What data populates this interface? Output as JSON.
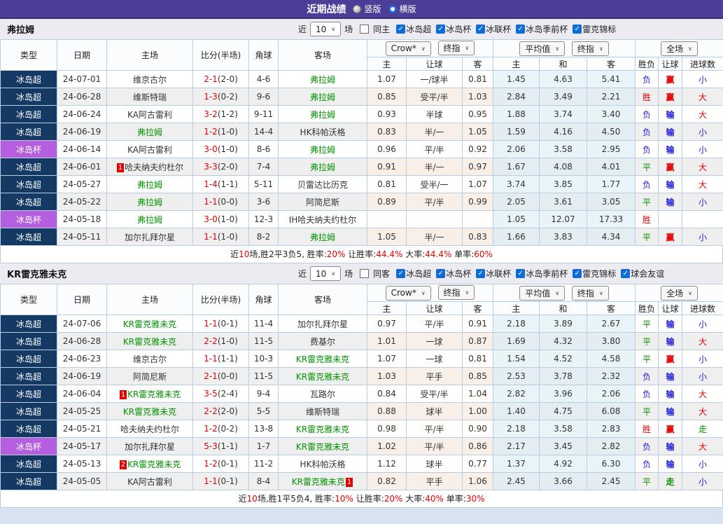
{
  "titlebar": {
    "title": "近期战绩",
    "radios": [
      {
        "label": "竖版",
        "selected": false
      },
      {
        "label": "横版",
        "selected": true
      }
    ]
  },
  "header": {
    "cols": [
      "类型",
      "日期",
      "主场",
      "比分(半场)",
      "角球",
      "客场"
    ],
    "dropdowns": [
      "Crow*",
      "终指",
      "平均值",
      "终指",
      "全场"
    ],
    "subcols": [
      "主",
      "让球",
      "客",
      "主",
      "和",
      "客",
      "胜负",
      "让球",
      "进球数"
    ]
  },
  "colors": {
    "titlebar": "#4c3d96",
    "league_super": "#143a64",
    "league_cup": "#b55fe0",
    "focus_team": "#009500",
    "win_red": "#e60000",
    "draw_green": "#089000",
    "lose_blue": "#2121dd",
    "score_red": "#e80000",
    "checkbox_blue": "#0e6cd6"
  },
  "sections": [
    {
      "team": "弗拉姆",
      "filter": {
        "prefix": "近",
        "count": "10",
        "suffix": "场",
        "same": "同主",
        "leagues": [
          "冰岛超",
          "冰岛杯",
          "冰联杯",
          "冰岛季前杯",
          "雷克锦标"
        ]
      },
      "rows": [
        {
          "type": "冰岛超",
          "tc": "super",
          "date": "24-07-01",
          "home": "维京古尔",
          "hg": false,
          "hb": "",
          "score": "2-1",
          "half": "(2-0)",
          "corner": "4-6",
          "away": "弗拉姆",
          "ag": true,
          "ab": "",
          "o1": [
            "1.07",
            "一/球半",
            "0.81"
          ],
          "o2": [
            "1.45",
            "4.63",
            "5.41"
          ],
          "res": [
            "负",
            "赢",
            "小"
          ]
        },
        {
          "type": "冰岛超",
          "tc": "super",
          "date": "24-06-28",
          "home": "维斯特瑞",
          "hg": false,
          "hb": "",
          "score": "1-3",
          "half": "(0-2)",
          "corner": "9-6",
          "away": "弗拉姆",
          "ag": true,
          "ab": "",
          "o1": [
            "0.85",
            "受平/半",
            "1.03"
          ],
          "o2": [
            "2.84",
            "3.49",
            "2.21"
          ],
          "res": [
            "胜",
            "赢",
            "大"
          ]
        },
        {
          "type": "冰岛超",
          "tc": "super",
          "date": "24-06-24",
          "home": "KA阿古雷利",
          "hg": false,
          "hb": "",
          "score": "3-2",
          "half": "(1-2)",
          "corner": "9-11",
          "away": "弗拉姆",
          "ag": true,
          "ab": "",
          "o1": [
            "0.93",
            "半球",
            "0.95"
          ],
          "o2": [
            "1.88",
            "3.74",
            "3.40"
          ],
          "res": [
            "负",
            "输",
            "大"
          ]
        },
        {
          "type": "冰岛超",
          "tc": "super",
          "date": "24-06-19",
          "home": "弗拉姆",
          "hg": true,
          "hb": "",
          "score": "1-2",
          "half": "(1-0)",
          "corner": "14-4",
          "away": "HK科帕沃格",
          "ag": false,
          "ab": "",
          "o1": [
            "0.83",
            "半/一",
            "1.05"
          ],
          "o2": [
            "1.59",
            "4.16",
            "4.50"
          ],
          "res": [
            "负",
            "输",
            "小"
          ]
        },
        {
          "type": "冰岛杯",
          "tc": "cup",
          "date": "24-06-14",
          "home": "KA阿古雷利",
          "hg": false,
          "hb": "",
          "score": "3-0",
          "half": "(1-0)",
          "corner": "8-6",
          "away": "弗拉姆",
          "ag": true,
          "ab": "",
          "o1": [
            "0.96",
            "平/半",
            "0.92"
          ],
          "o2": [
            "2.06",
            "3.58",
            "2.95"
          ],
          "res": [
            "负",
            "输",
            "小"
          ]
        },
        {
          "type": "冰岛超",
          "tc": "super",
          "date": "24-06-01",
          "home": "哈夫纳夫约杜尔",
          "hg": false,
          "hb": "1",
          "score": "3-3",
          "half": "(2-0)",
          "corner": "7-4",
          "away": "弗拉姆",
          "ag": true,
          "ab": "",
          "o1": [
            "0.91",
            "半/一",
            "0.97"
          ],
          "o2": [
            "1.67",
            "4.08",
            "4.01"
          ],
          "res": [
            "平",
            "赢",
            "大"
          ]
        },
        {
          "type": "冰岛超",
          "tc": "super",
          "date": "24-05-27",
          "home": "弗拉姆",
          "hg": true,
          "hb": "",
          "score": "1-4",
          "half": "(1-1)",
          "corner": "5-11",
          "away": "贝雷达比历克",
          "ag": false,
          "ab": "",
          "o1": [
            "0.81",
            "受半/一",
            "1.07"
          ],
          "o2": [
            "3.74",
            "3.85",
            "1.77"
          ],
          "res": [
            "负",
            "输",
            "大"
          ]
        },
        {
          "type": "冰岛超",
          "tc": "super",
          "date": "24-05-22",
          "home": "弗拉姆",
          "hg": true,
          "hb": "",
          "score": "1-1",
          "half": "(0-0)",
          "corner": "3-6",
          "away": "阿简尼斯",
          "ag": false,
          "ab": "",
          "o1": [
            "0.89",
            "平/半",
            "0.99"
          ],
          "o2": [
            "2.05",
            "3.61",
            "3.05"
          ],
          "res": [
            "平",
            "输",
            "小"
          ]
        },
        {
          "type": "冰岛杯",
          "tc": "cup",
          "date": "24-05-18",
          "home": "弗拉姆",
          "hg": true,
          "hb": "",
          "score": "3-0",
          "half": "(1-0)",
          "corner": "12-3",
          "away": "IH哈夫纳夫约杜尔",
          "ag": false,
          "ab": "",
          "o1": [
            "",
            "",
            ""
          ],
          "o2": [
            "1.05",
            "12.07",
            "17.33"
          ],
          "res": [
            "胜",
            "",
            ""
          ]
        },
        {
          "type": "冰岛超",
          "tc": "super",
          "date": "24-05-11",
          "home": "加尔扎拜尔星",
          "hg": false,
          "hb": "",
          "score": "1-1",
          "half": "(1-0)",
          "corner": "8-2",
          "away": "弗拉姆",
          "ag": true,
          "ab": "",
          "o1": [
            "1.05",
            "半/一",
            "0.83"
          ],
          "o2": [
            "1.66",
            "3.83",
            "4.34"
          ],
          "res": [
            "平",
            "赢",
            "小"
          ]
        }
      ],
      "summary": [
        {
          "t": "近",
          "red": false
        },
        {
          "t": "10",
          "red": true
        },
        {
          "t": "场,胜2平3负5, 胜率:",
          "red": false
        },
        {
          "t": "20%",
          "red": true
        },
        {
          "t": " 让胜率:",
          "red": false
        },
        {
          "t": "44.4%",
          "red": true
        },
        {
          "t": " 大率:",
          "red": false
        },
        {
          "t": "44.4%",
          "red": true
        },
        {
          "t": " 单率:",
          "red": false
        },
        {
          "t": "60%",
          "red": true
        }
      ]
    },
    {
      "team": "KR雷克雅未克",
      "filter": {
        "prefix": "近",
        "count": "10",
        "suffix": "场",
        "same": "同客",
        "leagues": [
          "冰岛超",
          "冰岛杯",
          "冰联杯",
          "冰岛季前杯",
          "雷克锦标",
          "球会友谊"
        ]
      },
      "rows": [
        {
          "type": "冰岛超",
          "tc": "super",
          "date": "24-07-06",
          "home": "KR雷克雅未克",
          "hg": true,
          "hb": "",
          "score": "1-1",
          "half": "(0-1)",
          "corner": "11-4",
          "away": "加尔扎拜尔星",
          "ag": false,
          "ab": "",
          "o1": [
            "0.97",
            "平/半",
            "0.91"
          ],
          "o2": [
            "2.18",
            "3.89",
            "2.67"
          ],
          "res": [
            "平",
            "输",
            "小"
          ]
        },
        {
          "type": "冰岛超",
          "tc": "super",
          "date": "24-06-28",
          "home": "KR雷克雅未克",
          "hg": true,
          "hb": "",
          "score": "2-2",
          "half": "(1-0)",
          "corner": "11-5",
          "away": "费基尔",
          "ag": false,
          "ab": "",
          "o1": [
            "1.01",
            "一球",
            "0.87"
          ],
          "o2": [
            "1.69",
            "4.32",
            "3.80"
          ],
          "res": [
            "平",
            "输",
            "大"
          ]
        },
        {
          "type": "冰岛超",
          "tc": "super",
          "date": "24-06-23",
          "home": "维京古尔",
          "hg": false,
          "hb": "",
          "score": "1-1",
          "half": "(1-1)",
          "corner": "10-3",
          "away": "KR雷克雅未克",
          "ag": true,
          "ab": "",
          "o1": [
            "1.07",
            "一球",
            "0.81"
          ],
          "o2": [
            "1.54",
            "4.52",
            "4.58"
          ],
          "res": [
            "平",
            "赢",
            "小"
          ]
        },
        {
          "type": "冰岛超",
          "tc": "super",
          "date": "24-06-19",
          "home": "阿简尼斯",
          "hg": false,
          "hb": "",
          "score": "2-1",
          "half": "(0-0)",
          "corner": "11-5",
          "away": "KR雷克雅未克",
          "ag": true,
          "ab": "",
          "o1": [
            "1.03",
            "平手",
            "0.85"
          ],
          "o2": [
            "2.53",
            "3.78",
            "2.32"
          ],
          "res": [
            "负",
            "输",
            "小"
          ]
        },
        {
          "type": "冰岛超",
          "tc": "super",
          "date": "24-06-04",
          "home": "KR雷克雅未克",
          "hg": true,
          "hb": "1",
          "score": "3-5",
          "half": "(2-4)",
          "corner": "9-4",
          "away": "瓦路尔",
          "ag": false,
          "ab": "",
          "o1": [
            "0.84",
            "受平/半",
            "1.04"
          ],
          "o2": [
            "2.82",
            "3.96",
            "2.06"
          ],
          "res": [
            "负",
            "输",
            "大"
          ]
        },
        {
          "type": "冰岛超",
          "tc": "super",
          "date": "24-05-25",
          "home": "KR雷克雅未克",
          "hg": true,
          "hb": "",
          "score": "2-2",
          "half": "(2-0)",
          "corner": "5-5",
          "away": "维斯特瑞",
          "ag": false,
          "ab": "",
          "o1": [
            "0.88",
            "球半",
            "1.00"
          ],
          "o2": [
            "1.40",
            "4.75",
            "6.08"
          ],
          "res": [
            "平",
            "输",
            "大"
          ]
        },
        {
          "type": "冰岛超",
          "tc": "super",
          "date": "24-05-21",
          "home": "哈夫纳夫约杜尔",
          "hg": false,
          "hb": "",
          "score": "1-2",
          "half": "(0-2)",
          "corner": "13-8",
          "away": "KR雷克雅未克",
          "ag": true,
          "ab": "",
          "o1": [
            "0.98",
            "平/半",
            "0.90"
          ],
          "o2": [
            "2.18",
            "3.58",
            "2.83"
          ],
          "res": [
            "胜",
            "赢",
            "走"
          ]
        },
        {
          "type": "冰岛杯",
          "tc": "cup",
          "date": "24-05-17",
          "home": "加尔扎拜尔星",
          "hg": false,
          "hb": "",
          "score": "5-3",
          "half": "(1-1)",
          "corner": "1-7",
          "away": "KR雷克雅未克",
          "ag": true,
          "ab": "",
          "o1": [
            "1.02",
            "平/半",
            "0.86"
          ],
          "o2": [
            "2.17",
            "3.45",
            "2.82"
          ],
          "res": [
            "负",
            "输",
            "大"
          ]
        },
        {
          "type": "冰岛超",
          "tc": "super",
          "date": "24-05-13",
          "home": "KR雷克雅未克",
          "hg": true,
          "hb": "2",
          "score": "1-2",
          "half": "(0-1)",
          "corner": "11-2",
          "away": "HK科帕沃格",
          "ag": false,
          "ab": "",
          "o1": [
            "1.12",
            "球半",
            "0.77"
          ],
          "o2": [
            "1.37",
            "4.92",
            "6.30"
          ],
          "res": [
            "负",
            "输",
            "小"
          ]
        },
        {
          "type": "冰岛超",
          "tc": "super",
          "date": "24-05-05",
          "home": "KA阿古雷利",
          "hg": false,
          "hb": "",
          "score": "1-1",
          "half": "(0-1)",
          "corner": "8-4",
          "away": "KR雷克雅未克",
          "ag": true,
          "ab": "1",
          "o1": [
            "0.82",
            "平手",
            "1.06"
          ],
          "o2": [
            "2.45",
            "3.66",
            "2.45"
          ],
          "res": [
            "平",
            "走",
            "小"
          ]
        }
      ],
      "summary": [
        {
          "t": "近",
          "red": false
        },
        {
          "t": "10",
          "red": true
        },
        {
          "t": "场,胜1平5负4, 胜率:",
          "red": false
        },
        {
          "t": "10%",
          "red": true
        },
        {
          "t": " 让胜率:",
          "red": false
        },
        {
          "t": "20%",
          "red": true
        },
        {
          "t": " 大率:",
          "red": false
        },
        {
          "t": "40%",
          "red": true
        },
        {
          "t": " 单率:",
          "red": false
        },
        {
          "t": "30%",
          "red": true
        }
      ]
    }
  ]
}
